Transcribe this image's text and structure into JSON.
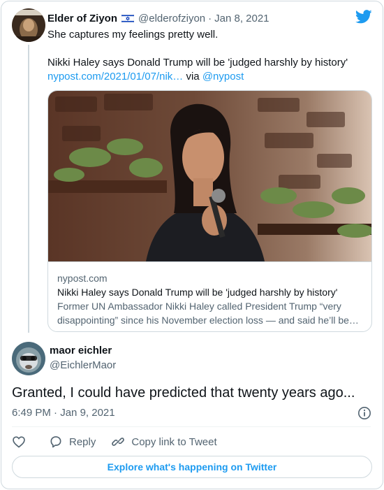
{
  "parent_tweet": {
    "author_name": "Elder of Ziyon",
    "flag_icon": "israel-flag-icon",
    "handle": "@elderofziyon",
    "separator": "·",
    "date": "Jan 8, 2021",
    "text_line1": "She captures my feelings pretty well.",
    "text_line2": "Nikki Haley says Donald Trump will be 'judged harshly by history'",
    "link_url": "nypost.com/2021/01/07/nik…",
    "via_text": "via",
    "via_handle": "@nypost"
  },
  "link_card": {
    "domain": "nypost.com",
    "title": "Nikki Haley says Donald Trump will be 'judged harshly by history'",
    "description": "Former UN Ambassador Nikki Haley called President Trump “very disappointing” since his November election loss — and said he’ll be judged harshly by history."
  },
  "main_tweet": {
    "author_name": "maor eichler",
    "handle": "@EichlerMaor",
    "text": "Granted, I could have predicted that twenty years ago...",
    "time": "6:49 PM",
    "separator": "·",
    "date": "Jan 9, 2021"
  },
  "actions": {
    "reply_label": "Reply",
    "copy_link_label": "Copy link to Tweet"
  },
  "footer": {
    "explore_label": "Explore what's happening on Twitter"
  },
  "colors": {
    "accent": "#1d9bf0",
    "text_primary": "#0f1419",
    "text_secondary": "#536471",
    "border": "#cfd9de"
  }
}
